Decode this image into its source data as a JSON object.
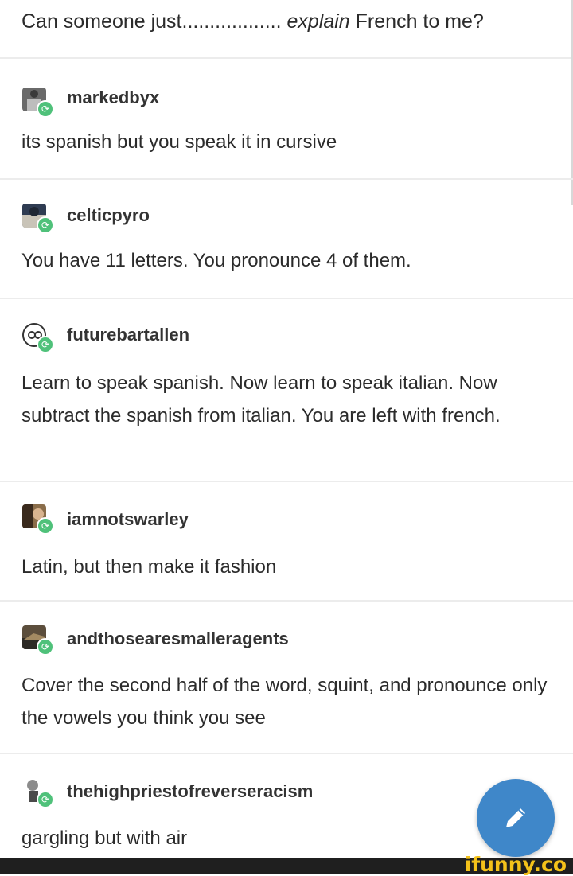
{
  "header": {
    "prefix": "Can someone just.................. ",
    "emphasis": "explain",
    "suffix": " French to me?"
  },
  "posts": [
    {
      "username": "markedbyx",
      "avatar_icon": "user-avatar-icon",
      "text": "its spanish but you speak it in cursive"
    },
    {
      "username": "celticpyro",
      "avatar_icon": "user-avatar-icon",
      "text": "You have 11 letters. You pronounce 4 of them."
    },
    {
      "username": "futurebartallen",
      "avatar_icon": "user-avatar-icon",
      "text": "Learn to speak spanish. Now learn to speak italian. Now subtract the spanish from italian. You are left with french."
    },
    {
      "username": "iamnotswarley",
      "avatar_icon": "user-avatar-icon",
      "text": "Latin, but then make it fashion"
    },
    {
      "username": "andthosearesmalleragents",
      "avatar_icon": "user-avatar-icon",
      "text": "Cover the second half of the word, squint, and pronounce only the vowels you think you see"
    },
    {
      "username": "thehighpriestofreverseracism",
      "avatar_icon": "user-avatar-icon",
      "text": "gargling but with air"
    }
  ],
  "compose_button": {
    "icon": "pencil-icon",
    "color": "#3f87c9"
  },
  "reblog_badge": {
    "icon": "reblog-icon",
    "color": "#4fc17a"
  },
  "watermark": {
    "text": "ifunny.co",
    "color": "#f4c21a"
  }
}
